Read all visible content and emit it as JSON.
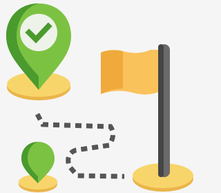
{
  "illustration": {
    "subject": "route-to-destination-flag",
    "icons": [
      "map-pin-check-icon",
      "map-pin-icon",
      "dashed-route-path",
      "flag-icon"
    ]
  },
  "colors": {
    "background": "#f5f5f5",
    "pin_green_light": "#7cc242",
    "pin_green_dark": "#4a9a2e",
    "check_circle": "#eef3ea",
    "check_mark": "#4a9a2e",
    "base_yellow": "#f8d56a",
    "base_yellow_dark": "#eab54a",
    "flag_light": "#f9c25b",
    "flag_dark": "#f0a93b",
    "pole_light": "#6a6a6a",
    "pole_dark": "#454545",
    "route_dash": "#555555"
  }
}
